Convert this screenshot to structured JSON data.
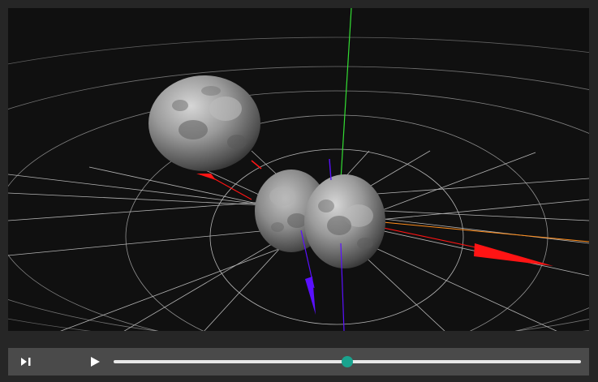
{
  "player": {
    "progress": 0.5,
    "step_icon": "step-forward-icon",
    "play_icon": "play-icon",
    "colors": {
      "background": "#262626",
      "viewport": "#101010",
      "control_bar": "#4a4a4a",
      "slider_track": "#e8e8e8",
      "slider_thumb": "#19a38e"
    }
  },
  "scene": {
    "objects": [
      "moon-sphere",
      "moon-sphere",
      "moon-sphere"
    ],
    "axes": {
      "x_axis_color": "#ff8c1a",
      "y_axis_color": "#33dd33",
      "z_axis_color": "#3333ff"
    },
    "vector_colors": {
      "red": "#ff1414",
      "purple": "#5a10ff"
    },
    "grid_color": "#d0d0d0"
  }
}
